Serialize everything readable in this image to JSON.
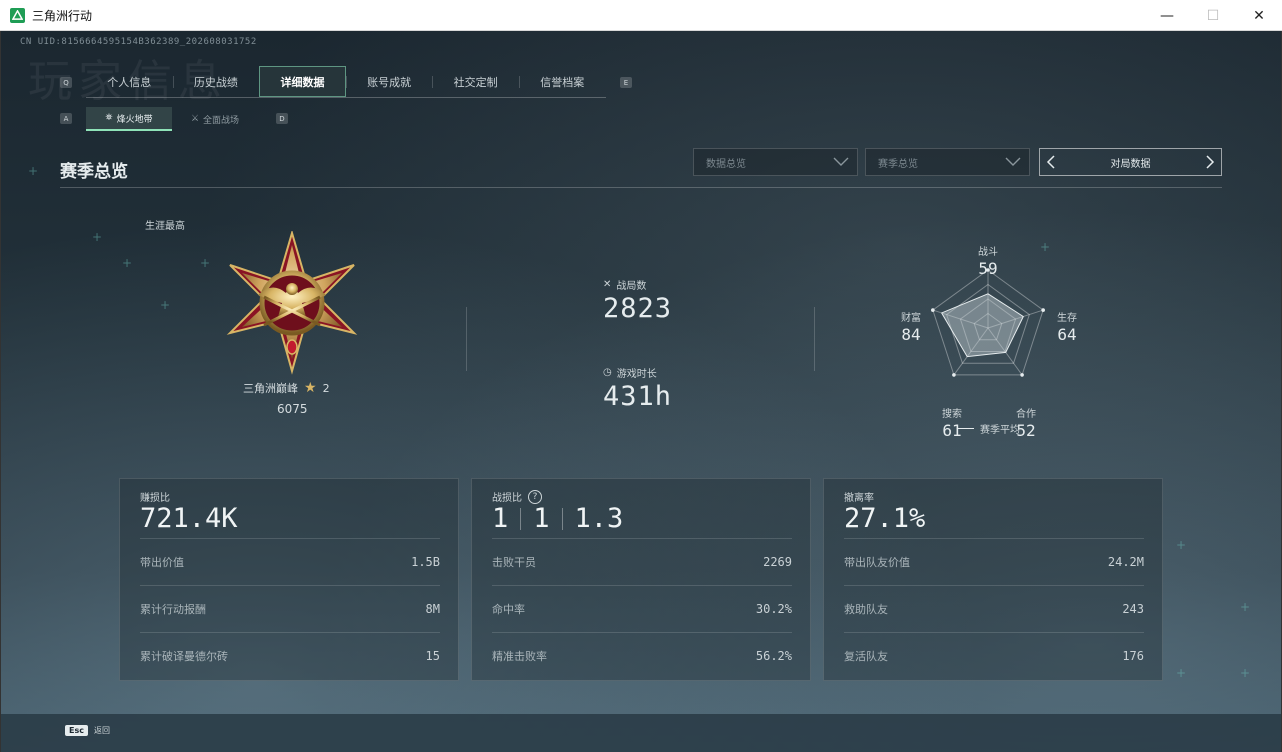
{
  "window": {
    "title": "三角洲行动",
    "controls": {
      "minimize": "—",
      "maximize": "☐",
      "close": "✕"
    }
  },
  "uid": "CN UID:8156664595154B362389_202608031752",
  "ghost_title": "玩家信息",
  "tabs": [
    {
      "label": "个人信息",
      "active": false
    },
    {
      "label": "历史战绩",
      "active": false
    },
    {
      "label": "详细数据",
      "active": true
    },
    {
      "label": "账号成就",
      "active": false
    },
    {
      "label": "社交定制",
      "active": false
    },
    {
      "label": "信誉档案",
      "active": false
    }
  ],
  "tab_keys": {
    "prev": "Q",
    "next": "E"
  },
  "subtabs": [
    {
      "label": "烽火地带",
      "active": true,
      "icon": "fire-zone-icon"
    },
    {
      "label": "全面战场",
      "active": false,
      "icon": "battlefield-icon"
    }
  ],
  "subtab_keys": {
    "prev": "A",
    "next": "D"
  },
  "section": {
    "title": "赛季总览",
    "dropdown1": "数据总览",
    "dropdown2": "赛季总览",
    "pager_label": "对局数据"
  },
  "career": {
    "label": "生涯最高",
    "rank_name": "三角洲巅峰",
    "stars": "2",
    "score": "6075"
  },
  "summary": {
    "matches_label": "战局数",
    "matches_value": "2823",
    "playtime_label": "游戏时长",
    "playtime_value": "431h"
  },
  "radar": {
    "axes": [
      {
        "label": "战斗",
        "value": "59",
        "score": 59
      },
      {
        "label": "生存",
        "value": "64",
        "score": 64
      },
      {
        "label": "合作",
        "value": "52",
        "score": 52
      },
      {
        "label": "搜索",
        "value": "61",
        "score": 61
      },
      {
        "label": "财富",
        "value": "84",
        "score": 84
      }
    ],
    "legend": "赛季平均"
  },
  "cards": [
    {
      "label": "赚损比",
      "big": [
        "721.4K"
      ],
      "help": false,
      "rows": [
        {
          "label": "带出价值",
          "value": "1.5B"
        },
        {
          "label": "累计行动报酬",
          "value": "8M"
        },
        {
          "label": "累计破译曼德尔砖",
          "value": "15"
        }
      ]
    },
    {
      "label": "战损比",
      "big": [
        "1",
        "1",
        "1.3"
      ],
      "help": true,
      "rows": [
        {
          "label": "击败干员",
          "value": "2269"
        },
        {
          "label": "命中率",
          "value": "30.2%"
        },
        {
          "label": "精准击败率",
          "value": "56.2%"
        }
      ]
    },
    {
      "label": "撤离率",
      "big": [
        "27.1%"
      ],
      "help": false,
      "rows": [
        {
          "label": "带出队友价值",
          "value": "24.2M"
        },
        {
          "label": "救助队友",
          "value": "243"
        },
        {
          "label": "复活队友",
          "value": "176"
        }
      ]
    }
  ],
  "footer": {
    "esc_key": "Esc",
    "esc_label": "返回"
  },
  "colors": {
    "accent": "#8fe3b8",
    "gold": "#d8b565",
    "medal_red": "#8a1424"
  }
}
